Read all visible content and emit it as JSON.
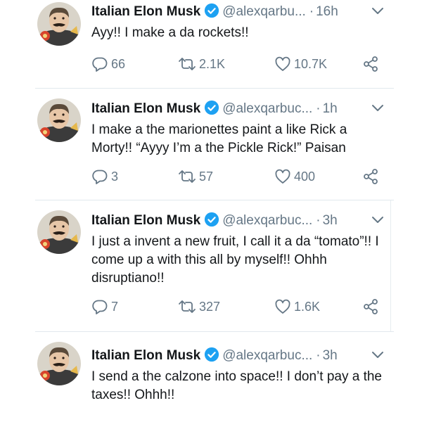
{
  "tweets": [
    {
      "name": "Italian Elon Musk",
      "handle": "@alexqarbu...",
      "time": "16h",
      "text": "Ayy!! I make a da rockets!!",
      "replies": "66",
      "retweets": "2.1K",
      "likes": "10.7K"
    },
    {
      "name": "Italian Elon Musk",
      "handle": "@alexqarbuc...",
      "time": "1h",
      "text": "I make a the marionettes paint a like Rick a Morty!! “Ayyy I’m a the Pickle Rick!” Paisan",
      "replies": "3",
      "retweets": "57",
      "likes": "400"
    },
    {
      "name": "Italian Elon Musk",
      "handle": "@alexqarbuc...",
      "time": "3h",
      "text": "I just a invent a new fruit, I call it a da “tomato”!! I come up a with this all by myself!! Ohhh disruptiano!!",
      "replies": "7",
      "retweets": "327",
      "likes": "1.6K"
    },
    {
      "name": "Italian Elon Musk",
      "handle": "@alexqarbuc...",
      "time": "3h",
      "text": "I send a the calzone into space!! I don’t pay a the taxes!! Ohhh!!"
    }
  ],
  "icons": {
    "verified": "verified-badge-icon",
    "caret": "chevron-down-icon",
    "reply": "reply-icon",
    "retweet": "retweet-icon",
    "like": "heart-icon",
    "share": "share-icon"
  },
  "colors": {
    "text": "#14171a",
    "secondary": "#657786",
    "verified": "#1da1f2",
    "divider": "#e1e8ed"
  }
}
